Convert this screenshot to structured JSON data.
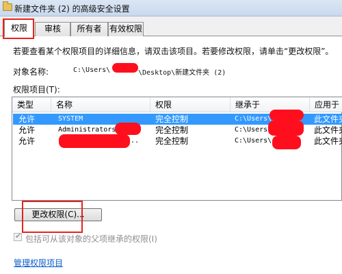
{
  "window": {
    "title": "新建文件夹 (2) 的高级安全设置"
  },
  "tabs": [
    "权限",
    "审核",
    "所有者",
    "有效权限"
  ],
  "instructions": "若要查看某个权限项目的详细信息，请双击该项目。若要修改权限，请单击“更改权限”。",
  "object": {
    "label": "对象名称:",
    "path_prefix": "C:\\Users\\",
    "path_suffix": "\\Desktop\\新建文件夹 (2)"
  },
  "entries_label": "权限项目(T):",
  "columns": [
    "类型",
    "名称",
    "权限",
    "继承于",
    "应用于"
  ],
  "rows": [
    {
      "type": "允许",
      "name": "SYSTEM",
      "permission": "完全控制",
      "inherited": "C:\\Users\\",
      "applies": "此文件夹",
      "selected": true
    },
    {
      "type": "允许",
      "name": "Administrators",
      "permission": "完全控制",
      "inherited": "C:\\Users\\",
      "applies": "此文件夹",
      "selected": false
    },
    {
      "type": "允许",
      "name": "...",
      "permission": "完全控制",
      "inherited": "C:\\Users\\",
      "applies": "此文件夹",
      "selected": false
    }
  ],
  "change_button": "更改权限(C)...",
  "inherit_checkbox": {
    "label": "包括可从该对象的父项继承的权限(I)",
    "checked": true,
    "enabled": false
  },
  "manage_link": "管理权限项目",
  "colors": {
    "selection": "#3399ff",
    "annotation": "#e8211d",
    "redaction": "#ff0f1e",
    "link": "#0d5ec9"
  }
}
